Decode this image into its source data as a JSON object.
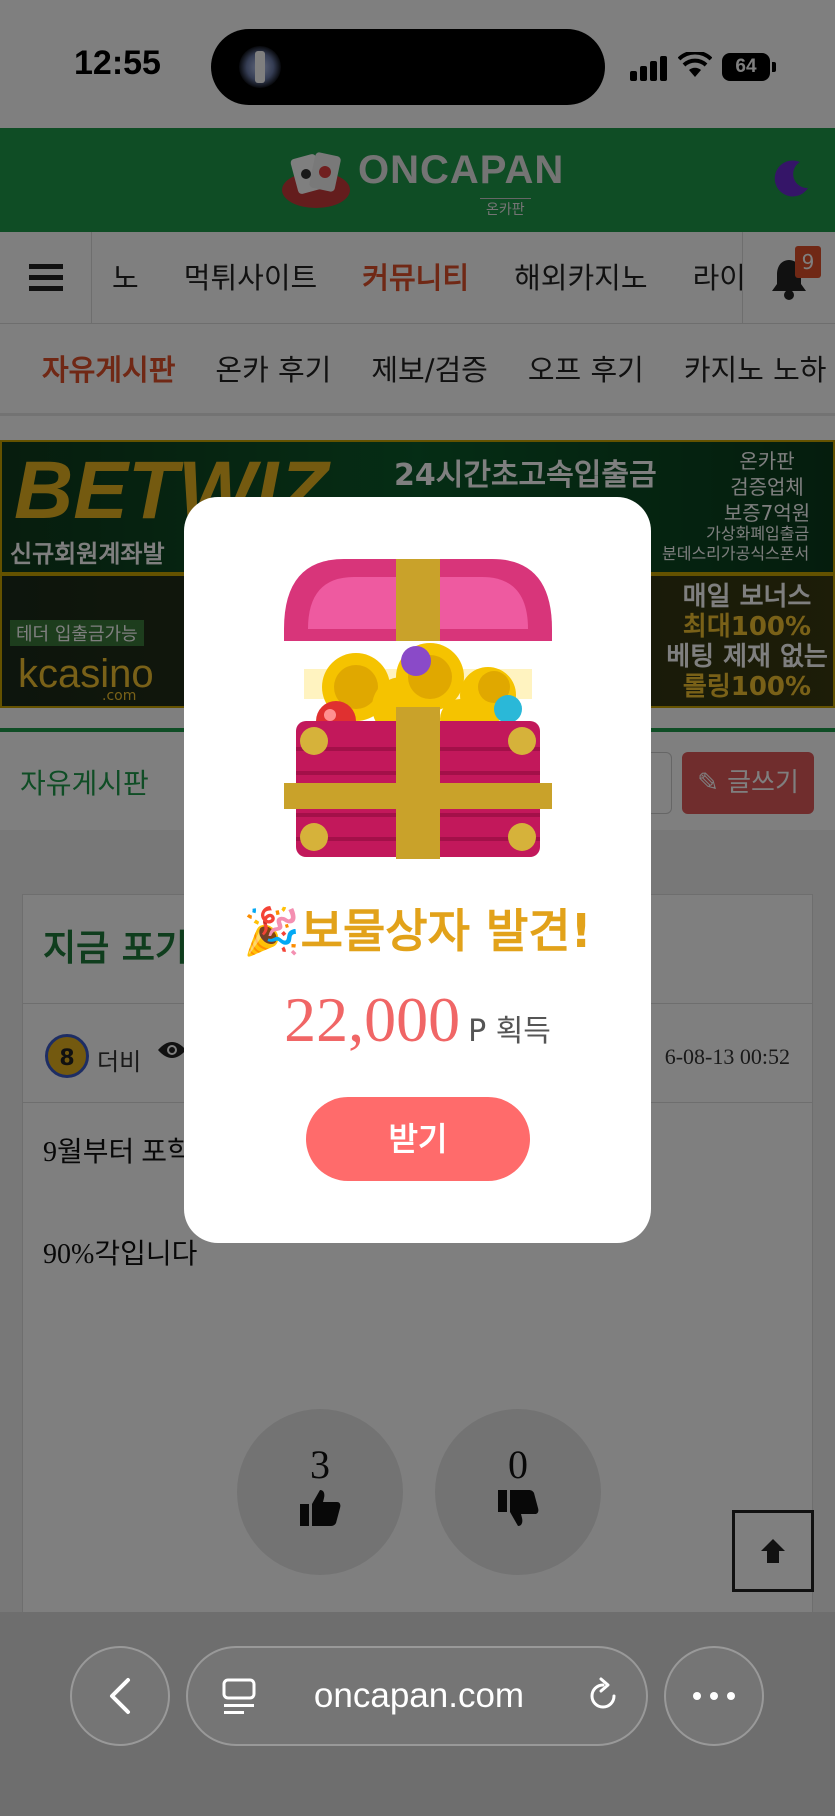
{
  "status": {
    "time": "12:55",
    "battery": "64"
  },
  "site": {
    "logo_text": "ONCAPAN",
    "logo_sub": "온카판"
  },
  "nav": {
    "items": [
      {
        "label": "노",
        "active": false
      },
      {
        "label": "먹튀사이트",
        "active": false
      },
      {
        "label": "커뮤니티",
        "active": true
      },
      {
        "label": "해외카지노",
        "active": false
      },
      {
        "label": "라이",
        "active": false
      }
    ],
    "notification_count": "9"
  },
  "subnav": {
    "items": [
      {
        "label": "자유게시판",
        "active": true
      },
      {
        "label": "온카 후기",
        "active": false
      },
      {
        "label": "제보/검증",
        "active": false
      },
      {
        "label": "오프 후기",
        "active": false
      },
      {
        "label": "카지노 노하",
        "active": false
      }
    ]
  },
  "banners": {
    "b1_brand": "BETWIZ",
    "b1_headline": "24시간초고속입출금",
    "b1_lead": "신규회원계좌발",
    "b1_badge": "온카판\n검증업체\n보증7억원",
    "b1_foot": "가상화폐입출금\n분데스리가공식스폰서",
    "b2_tether": "테더 입출금가능",
    "b2_brand": "kcasino",
    "b2_brand_sub": ".com",
    "b2_line1": "매일 보너스",
    "b2_line2": "최대100%",
    "b2_line3": "베팅 제재 없는",
    "b2_line4": "롤링100%"
  },
  "board": {
    "title": "자유게시판",
    "write_label": "글쓰기"
  },
  "post": {
    "title": "지금 포기",
    "level": "8",
    "author": "더비",
    "date": "6-08-13 00:52",
    "body1": "9월부터 포학",
    "body2": "90%각입니다",
    "upvotes": "3",
    "downvotes": "0"
  },
  "popup": {
    "title": "🎉보물상자 발견!",
    "amount": "22,000",
    "unit": "P 획득",
    "button": "받기"
  },
  "browser": {
    "url": "oncapan.com"
  }
}
